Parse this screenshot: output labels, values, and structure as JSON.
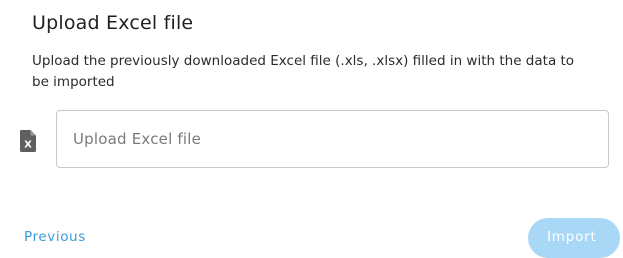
{
  "dialog": {
    "title": "Upload Excel file",
    "description": "Upload the previously downloaded Excel file (.xls, .xlsx) filled in with the data to be imported"
  },
  "upload": {
    "placeholder": "Upload Excel file",
    "icon": "excel-file-icon",
    "icon_letter": "X"
  },
  "actions": {
    "previous_label": "Previous",
    "import_label": "Import"
  },
  "colors": {
    "accent": "#3a9ad9",
    "import_disabled": "#a9d8f7",
    "icon": "#5f5f5f"
  }
}
